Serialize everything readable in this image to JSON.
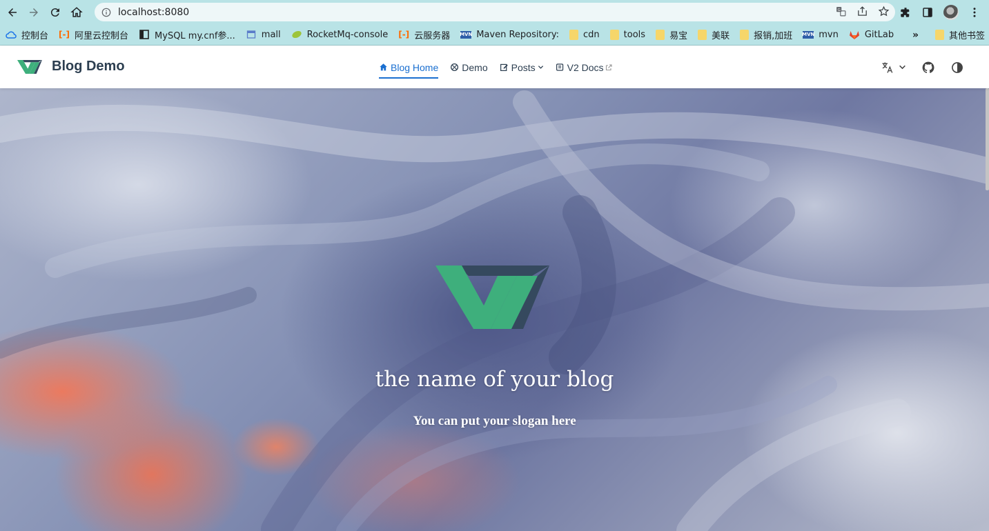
{
  "browser": {
    "url": "localhost:8080",
    "bookmarks": [
      {
        "label": "控制台",
        "icon": "cloud-icon"
      },
      {
        "label": "阿里云控制台",
        "icon": "aliyun-icon"
      },
      {
        "label": "MySQL my.cnf参...",
        "icon": "mysql-icon"
      },
      {
        "label": "mall",
        "icon": "page-icon"
      },
      {
        "label": "RocketMq-console",
        "icon": "leaf-icon"
      },
      {
        "label": "云服务器",
        "icon": "aliyun-icon"
      },
      {
        "label": "Maven Repository:",
        "icon": "mvn-icon"
      },
      {
        "label": "cdn",
        "icon": "folder-icon"
      },
      {
        "label": "tools",
        "icon": "folder-icon"
      },
      {
        "label": "易宝",
        "icon": "folder-icon"
      },
      {
        "label": "美联",
        "icon": "folder-icon"
      },
      {
        "label": "报销,加班",
        "icon": "folder-icon"
      },
      {
        "label": "mvn",
        "icon": "mvn-icon"
      },
      {
        "label": "GitLab",
        "icon": "gitlab-icon"
      }
    ],
    "more_label": "»",
    "other_bookmarks": "其他书签"
  },
  "navbar": {
    "site_name": "Blog Demo",
    "links": [
      {
        "label": "Blog Home",
        "icon": "home-icon",
        "active": true
      },
      {
        "label": "Demo",
        "icon": "demo-icon"
      },
      {
        "label": "Posts",
        "icon": "edit-icon",
        "dropdown": true
      },
      {
        "label": "V2 Docs",
        "icon": "docs-icon",
        "external": true
      }
    ]
  },
  "hero": {
    "title": "the name of your blog",
    "slogan": "You can put your slogan here"
  },
  "colors": {
    "accent": "#1a6fd0",
    "logo_green": "#3eaf7c",
    "logo_dark": "#35495e",
    "chrome": "#b9e3e6"
  }
}
